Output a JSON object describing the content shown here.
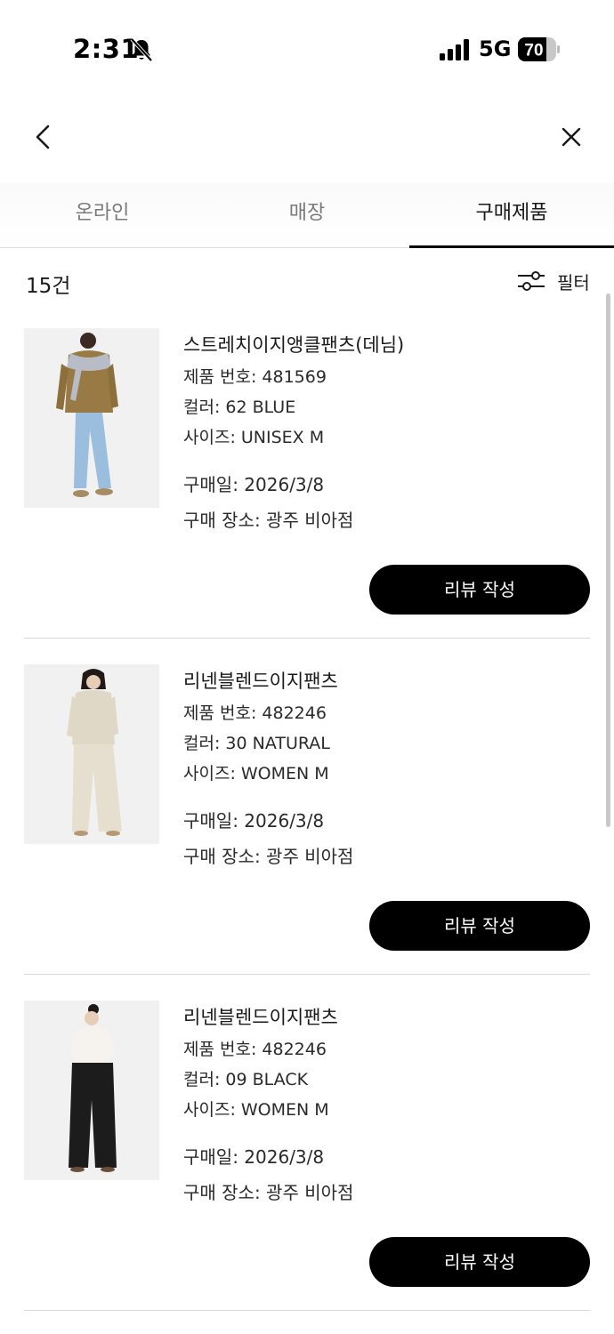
{
  "status_bar": {
    "time": "2:31",
    "network": "5G",
    "battery": "70"
  },
  "tabs": [
    {
      "label": "온라인",
      "active": false
    },
    {
      "label": "매장",
      "active": false
    },
    {
      "label": "구매제품",
      "active": true
    }
  ],
  "list_header": {
    "count": "15건",
    "filter_label": "필터"
  },
  "items": [
    {
      "name": "스트레치이지앵클팬츠(데님)",
      "product_no": "제품 번호: 481569",
      "color": "컬러: 62 BLUE",
      "size": "사이즈: UNISEX M",
      "purchase_date": "구매일: 2026/3/8",
      "store": "구매 장소: 광주 비아점",
      "button": "리뷰 작성"
    },
    {
      "name": "리넨블렌드이지팬츠",
      "product_no": "제품 번호: 482246",
      "color": "컬러: 30 NATURAL",
      "size": "사이즈: WOMEN M",
      "purchase_date": "구매일: 2026/3/8",
      "store": "구매 장소: 광주 비아점",
      "button": "리뷰 작성"
    },
    {
      "name": "리넨블렌드이지팬츠",
      "product_no": "제품 번호: 482246",
      "color": "컬러: 09 BLACK",
      "size": "사이즈: WOMEN M",
      "purchase_date": "구매일: 2026/3/8",
      "store": "구매 장소: 광주 비아점",
      "button": "리뷰 작성"
    }
  ],
  "icons": {
    "bell": "bell-slash-icon",
    "signal": "signal-icon",
    "battery": "battery-icon",
    "back": "chevron-left-icon",
    "close": "close-icon",
    "filter": "sliders-icon"
  }
}
